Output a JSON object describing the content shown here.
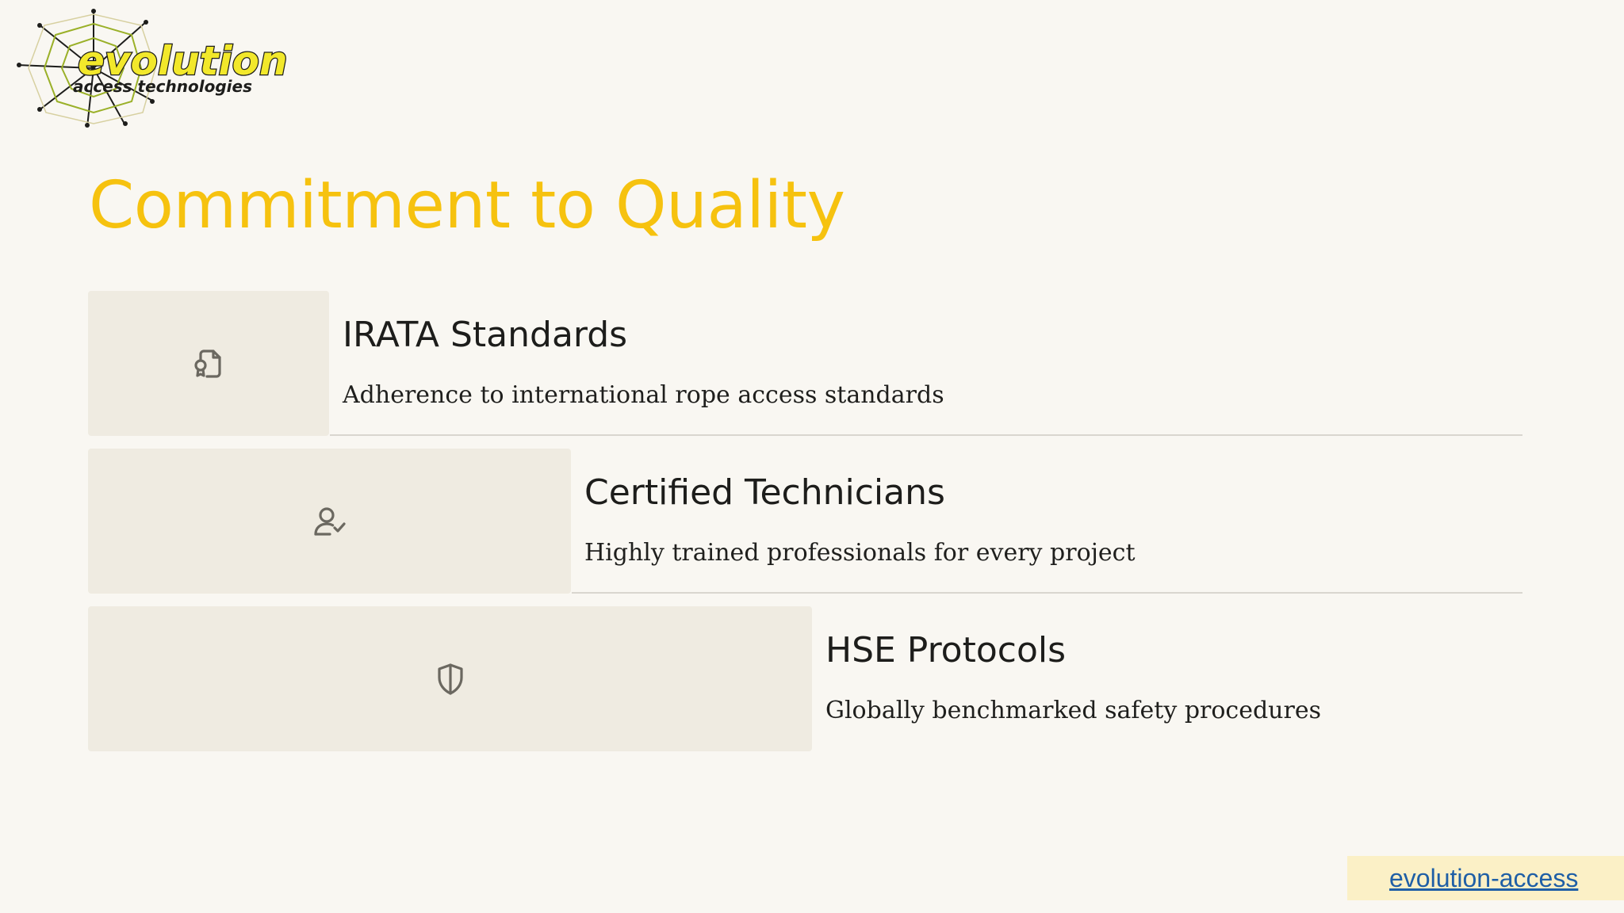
{
  "logo": {
    "wordmark": "evolution",
    "tagline": "access technologies"
  },
  "page": {
    "title": "Commitment to Quality"
  },
  "items": [
    {
      "icon": "certificate-document-icon",
      "title": "IRATA Standards",
      "description": "Adherence to international rope access standards"
    },
    {
      "icon": "user-check-icon",
      "title": "Certified Technicians",
      "description": "Highly trained professionals for every project"
    },
    {
      "icon": "shield-icon",
      "title": "HSE Protocols",
      "description": "Globally benchmarked safety procedures"
    }
  ],
  "footer": {
    "link_text": "evolution-access"
  },
  "colors": {
    "accent": "#f6c20f",
    "background": "#f9f7f2",
    "icon_box": "#efebe1",
    "link": "#1f5fa6",
    "link_box": "#fbf0c6"
  }
}
